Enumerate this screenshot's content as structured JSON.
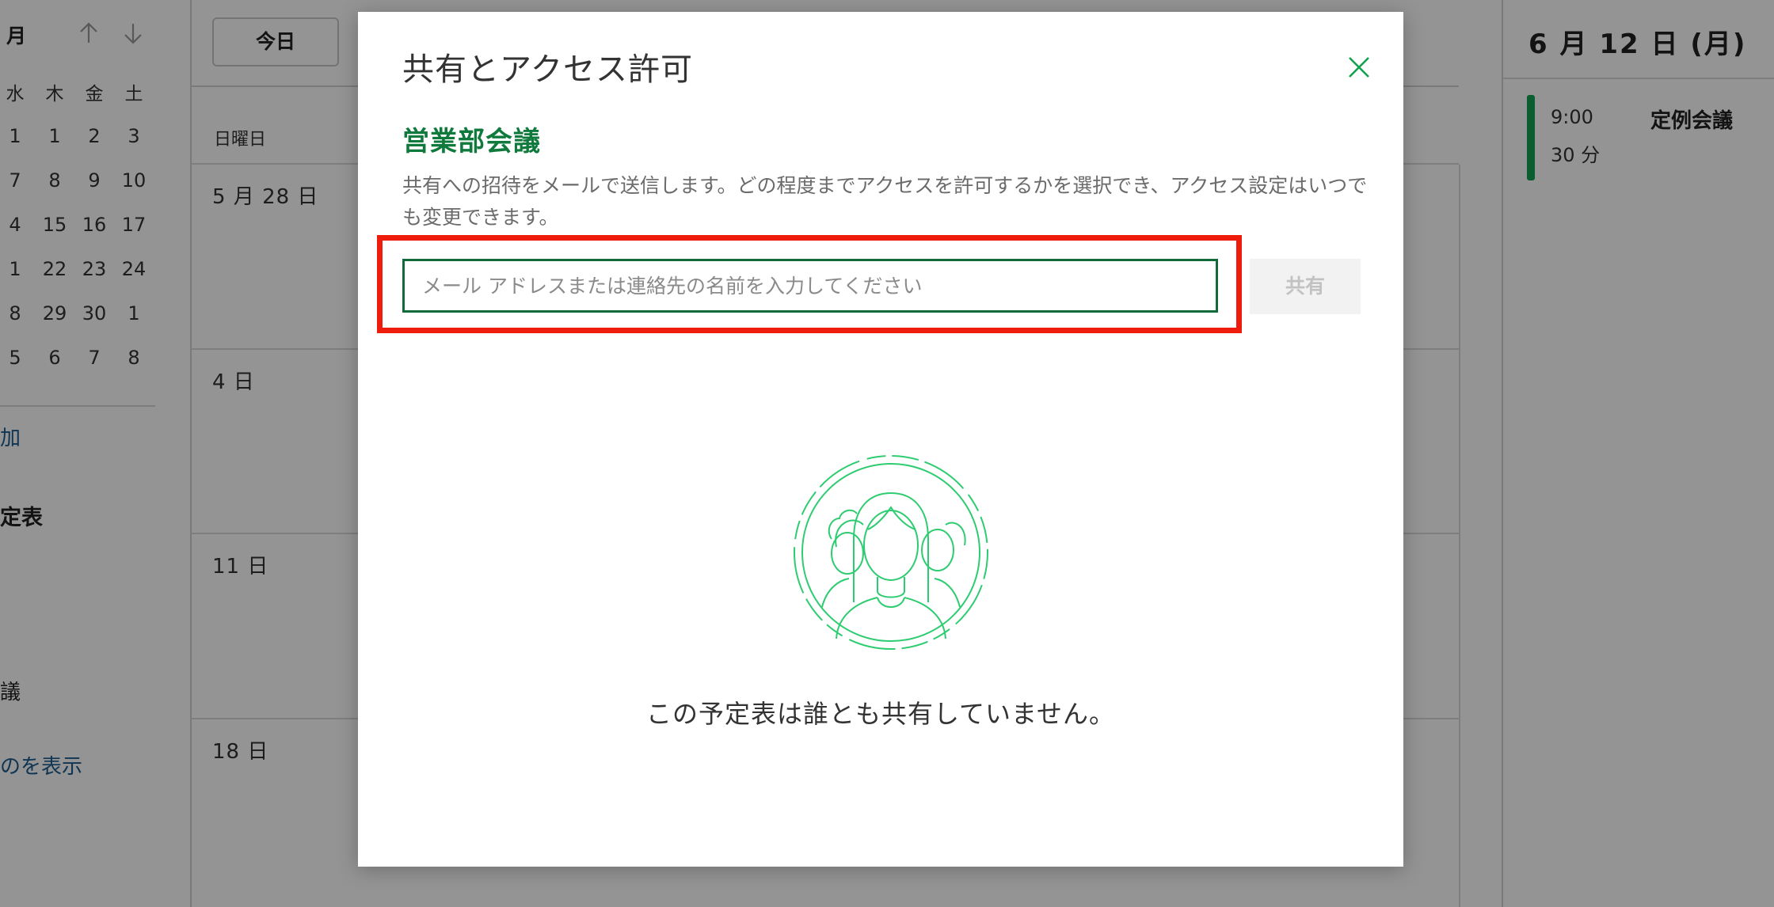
{
  "mini_calendar": {
    "month_label": "月",
    "weekdays": [
      "水",
      "木",
      "金",
      "土"
    ],
    "rows": [
      [
        "1",
        "1",
        "2",
        "3"
      ],
      [
        "7",
        "8",
        "9",
        "10"
      ],
      [
        "4",
        "15",
        "16",
        "17"
      ],
      [
        "1",
        "22",
        "23",
        "24"
      ],
      [
        "8",
        "29",
        "30",
        "1"
      ],
      [
        "5",
        "6",
        "7",
        "8"
      ]
    ]
  },
  "sidebar": {
    "add_link": "加",
    "calendars_heading": "定表",
    "item": "議",
    "show_more": "のを表示"
  },
  "toolbar": {
    "today_label": "今日"
  },
  "month_view": {
    "weekday_header": "日曜日",
    "weeks": [
      "5 月 28 日",
      "4 日",
      "11 日",
      "18 日"
    ]
  },
  "agenda": {
    "date": "6 月 12 日 (月)",
    "event": {
      "time": "9:00",
      "duration": "30 分",
      "title": "定例会議"
    },
    "accent_color": "#12a150"
  },
  "modal": {
    "title": "共有とアクセス許可",
    "calendar_name": "営業部会議",
    "description": "共有への招待をメールで送信します。どの程度までアクセスを許可するかを選択でき、アクセス設定はいつでも変更できます。",
    "email_input": {
      "value": "",
      "placeholder": "メール アドレスまたは連絡先の名前を入力してください"
    },
    "share_label": "共有",
    "empty_message": "この予定表は誰とも共有していません。",
    "close_icon": "close-icon",
    "illustration_icon": "people-illustration-icon",
    "accent_color": "#0f7a3c",
    "highlight_color": "#ee1c0c"
  }
}
